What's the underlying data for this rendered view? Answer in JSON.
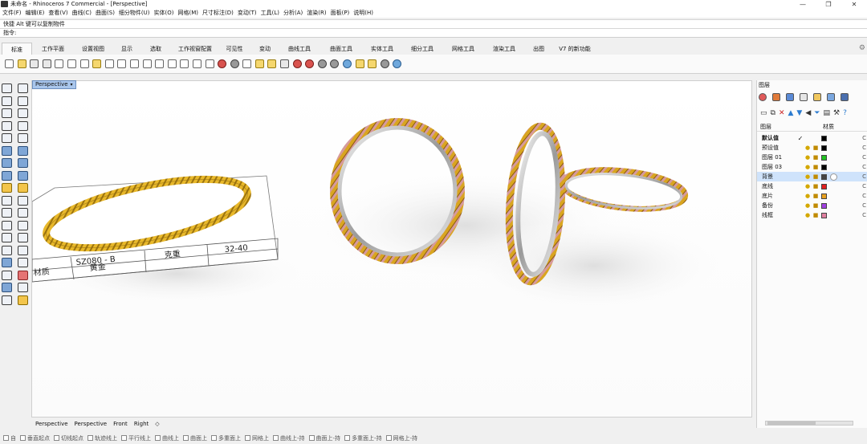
{
  "window": {
    "title": "未命名 - Rhinoceros 7 Commercial - [Perspective]",
    "controls": [
      "—",
      "❐",
      "✕"
    ]
  },
  "menu": [
    "文件(F)",
    "编辑(E)",
    "查看(V)",
    "曲线(C)",
    "曲面(S)",
    "细分物件(U)",
    "实体(O)",
    "网格(M)",
    "尺寸标注(D)",
    "变动(T)",
    "工具(L)",
    "分析(A)",
    "渲染(R)",
    "面板(P)",
    "说明(H)"
  ],
  "command": {
    "history": "快捷 Alt 键可以复制物件",
    "prompt": "指令:"
  },
  "tabs": [
    "标准",
    "工作平面",
    "设置视图",
    "显示",
    "选取",
    "工作视窗配置",
    "可见性",
    "变动",
    "曲线工具",
    "曲面工具",
    "实体工具",
    "细分工具",
    "网格工具",
    "渲染工具",
    "出图",
    "V7 的新功能"
  ],
  "active_tab": "标准",
  "viewport": {
    "label": "Perspective",
    "tabs": [
      "Perspective",
      "Perspective",
      "Front",
      "Right"
    ],
    "active_tab_index": 1,
    "add_tab_icon": "◇",
    "card": {
      "row1": [
        "SZ080 - B",
        "克重",
        "32-40"
      ],
      "row2": [
        "材质",
        "黄金"
      ]
    },
    "colors": {
      "gold": "#d9a520",
      "rose": "#d69a9c",
      "silver": "#c8c8c8"
    }
  },
  "layers_panel": {
    "title": "图层",
    "header_name": "图层",
    "header_material": "材质",
    "rows": [
      {
        "name": "默认值",
        "current": "✓",
        "color": "#000000",
        "bold": true
      },
      {
        "name": "预设值",
        "current": "",
        "color": "#000000"
      },
      {
        "name": "图层 01",
        "current": "",
        "color": "#20c020"
      },
      {
        "name": "图层 03",
        "current": "",
        "color": "#000000"
      },
      {
        "name": "背景",
        "current": "",
        "color": "#444444",
        "selected": true
      },
      {
        "name": "底线",
        "current": "",
        "color": "#e02020"
      },
      {
        "name": "底片",
        "current": "",
        "color": "#e8a020"
      },
      {
        "name": "备份",
        "current": "",
        "color": "#a040e0"
      },
      {
        "name": "线框",
        "current": "",
        "color": "#e080a0"
      }
    ]
  },
  "status_snaps": [
    "自",
    "垂直起点",
    "切线起点",
    "轨迹线上",
    "平行线上",
    "曲线上",
    "曲面上",
    "多重面上",
    "网格上",
    "曲线上-持",
    "曲面上-持",
    "多重面上-持",
    "网格上-持"
  ]
}
